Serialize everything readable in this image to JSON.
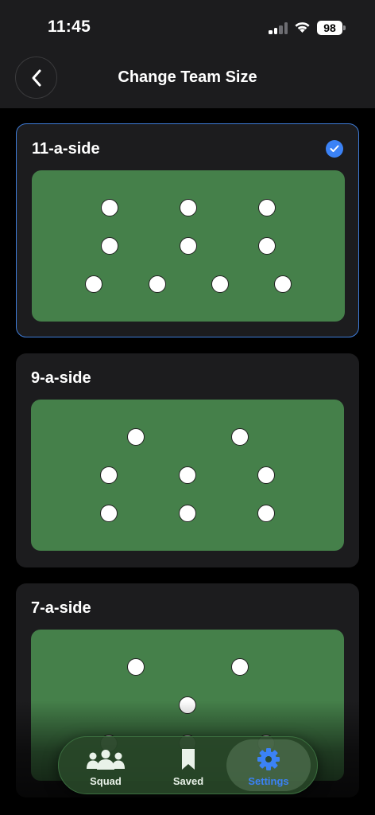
{
  "status_bar": {
    "time": "11:45",
    "battery": "98"
  },
  "header": {
    "title": "Change Team Size"
  },
  "options": [
    {
      "label": "11-a-side",
      "selected": true
    },
    {
      "label": "9-a-side",
      "selected": false
    },
    {
      "label": "7-a-side",
      "selected": false
    }
  ],
  "tab_bar": {
    "items": [
      {
        "label": "Squad",
        "icon": "users-icon"
      },
      {
        "label": "Saved",
        "icon": "bookmark-icon"
      },
      {
        "label": "Settings",
        "icon": "gear-icon",
        "active": true
      }
    ]
  },
  "colors": {
    "pitch": "#45804a",
    "accent": "#3b82f6",
    "card": "#1c1c1e"
  }
}
